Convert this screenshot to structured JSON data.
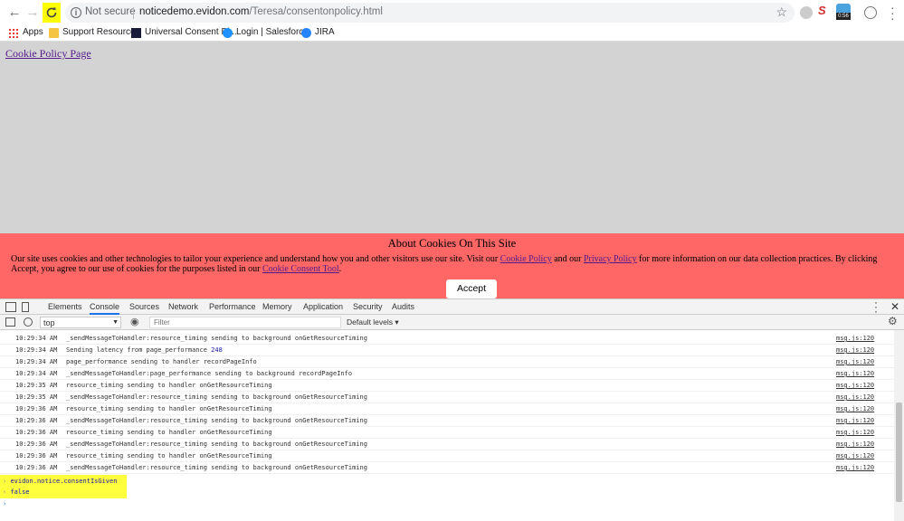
{
  "browser": {
    "security_label": "Not secure",
    "url_host": "noticedemo.evidon.com",
    "url_path": "/Teresa/consentonpolicy.html",
    "extension_badge": "0:56"
  },
  "bookmarks": [
    {
      "label": "Apps"
    },
    {
      "label": "Support Resources"
    },
    {
      "label": "Universal Consent Pl..."
    },
    {
      "label": "Login | Salesforce"
    },
    {
      "label": "JIRA"
    }
  ],
  "page": {
    "link_text": "Cookie Policy Page",
    "banner": {
      "title": "About Cookies On This Site",
      "text_1": "Our site uses cookies and other technologies to tailor your experience and understand how you and other visitors use our site. Visit our ",
      "link_cookie_policy": "Cookie Policy",
      "text_2": " and our ",
      "link_privacy_policy": "Privacy Policy",
      "text_3": " for more information on our data collection practices. By clicking Accept, you agree to our use of cookies for the purposes listed in our ",
      "link_consent_tool": "Cookie Consent Tool",
      "text_4": ".",
      "accept_label": "Accept"
    }
  },
  "devtools": {
    "tabs": [
      "Elements",
      "Console",
      "Sources",
      "Network",
      "Performance",
      "Memory",
      "Application",
      "Security",
      "Audits"
    ],
    "active_tab": "Console",
    "context": "top",
    "filter_placeholder": "Filter",
    "levels": "Default levels ▾",
    "logs": [
      {
        "time": "10:29:34 AM",
        "msg": "_sendMessageToHandler:resource_timing sending to background onGetResourceTiming",
        "num": "",
        "src": "msg.js:120"
      },
      {
        "time": "10:29:34 AM",
        "msg": "Sending latency from page_performance ",
        "num": "248",
        "src": "msg.js:120"
      },
      {
        "time": "10:29:34 AM",
        "msg": "page_performance sending to handler recordPageInfo",
        "num": "",
        "src": "msg.js:120"
      },
      {
        "time": "10:29:34 AM",
        "msg": "_sendMessageToHandler:page_performance sending to background recordPageInfo",
        "num": "",
        "src": "msg.js:120"
      },
      {
        "time": "10:29:35 AM",
        "msg": "resource_timing sending to handler onGetResourceTiming",
        "num": "",
        "src": "msg.js:120"
      },
      {
        "time": "10:29:35 AM",
        "msg": "_sendMessageToHandler:resource_timing sending to background onGetResourceTiming",
        "num": "",
        "src": "msg.js:120"
      },
      {
        "time": "10:29:36 AM",
        "msg": "resource_timing sending to handler onGetResourceTiming",
        "num": "",
        "src": "msg.js:120"
      },
      {
        "time": "10:29:36 AM",
        "msg": "_sendMessageToHandler:resource_timing sending to background onGetResourceTiming",
        "num": "",
        "src": "msg.js:120"
      },
      {
        "time": "10:29:36 AM",
        "msg": "resource_timing sending to handler onGetResourceTiming",
        "num": "",
        "src": "msg.js:120"
      },
      {
        "time": "10:29:36 AM",
        "msg": "_sendMessageToHandler:resource_timing sending to background onGetResourceTiming",
        "num": "",
        "src": "msg.js:120"
      },
      {
        "time": "10:29:36 AM",
        "msg": "resource_timing sending to handler onGetResourceTiming",
        "num": "",
        "src": "msg.js:120"
      },
      {
        "time": "10:29:36 AM",
        "msg": "_sendMessageToHandler:resource_timing sending to background onGetResourceTiming",
        "num": "",
        "src": "msg.js:120"
      }
    ],
    "command": "evidon.notice.consentIsGiven",
    "result": "false",
    "input_prompt": "›"
  }
}
